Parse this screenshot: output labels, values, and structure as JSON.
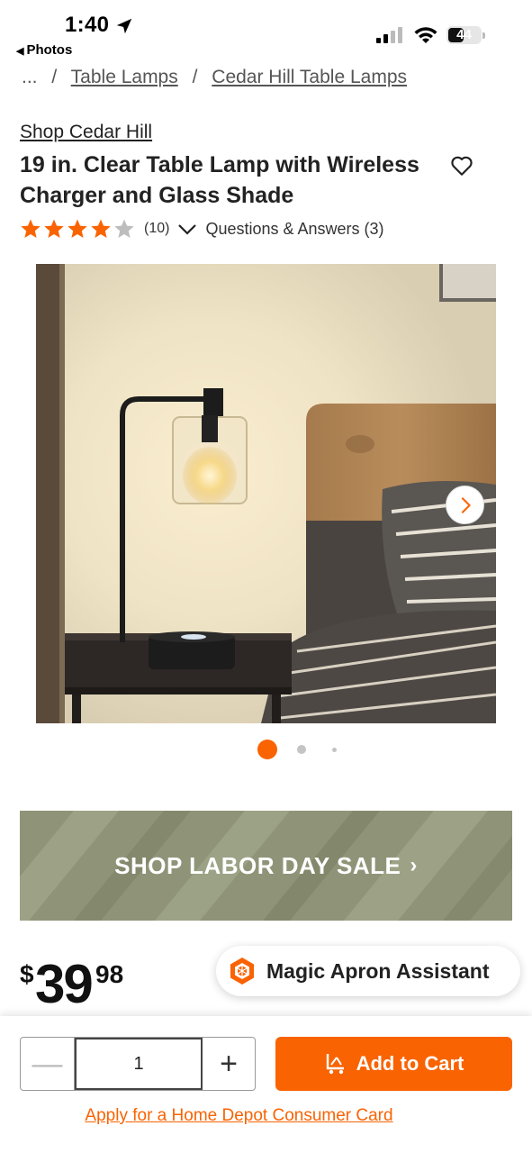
{
  "status_bar": {
    "time": "1:40",
    "back_app": "Photos",
    "battery": "44"
  },
  "breadcrumb": [
    "...",
    "/",
    "Table Lamps",
    "/",
    "Cedar Hill Table Lamps"
  ],
  "product": {
    "brand": "Shop Cedar Hill",
    "title": "19 in. Clear Table Lamp with Wireless Charger and Glass Shade",
    "rating": 4,
    "rating_max": 5,
    "review_count": "(10)",
    "qa_label": "Questions & Answers (3)"
  },
  "gallery": {
    "image_count": 3,
    "active_index": 0
  },
  "banner": {
    "label": "SHOP LABOR DAY SALE",
    "chevron": "›"
  },
  "price": {
    "currency": "$",
    "dollars": "39",
    "cents": "98"
  },
  "assistant": {
    "label": "Magic Apron Assistant"
  },
  "purchase": {
    "minus": "—",
    "quantity": "1",
    "plus": "+",
    "add_to_cart": "Add to Cart",
    "apply_link": "Apply for a Home Depot Consumer Card"
  },
  "colors": {
    "accent": "#f96302",
    "star": "#f96302",
    "banner": "#8f9478"
  },
  "icons": [
    "location-arrow-icon",
    "signal-icon",
    "wifi-icon",
    "battery-icon",
    "heart-icon",
    "star-icon",
    "chevron-down-icon",
    "chevron-right-icon",
    "magic-apron-logo-icon",
    "cart-icon"
  ]
}
